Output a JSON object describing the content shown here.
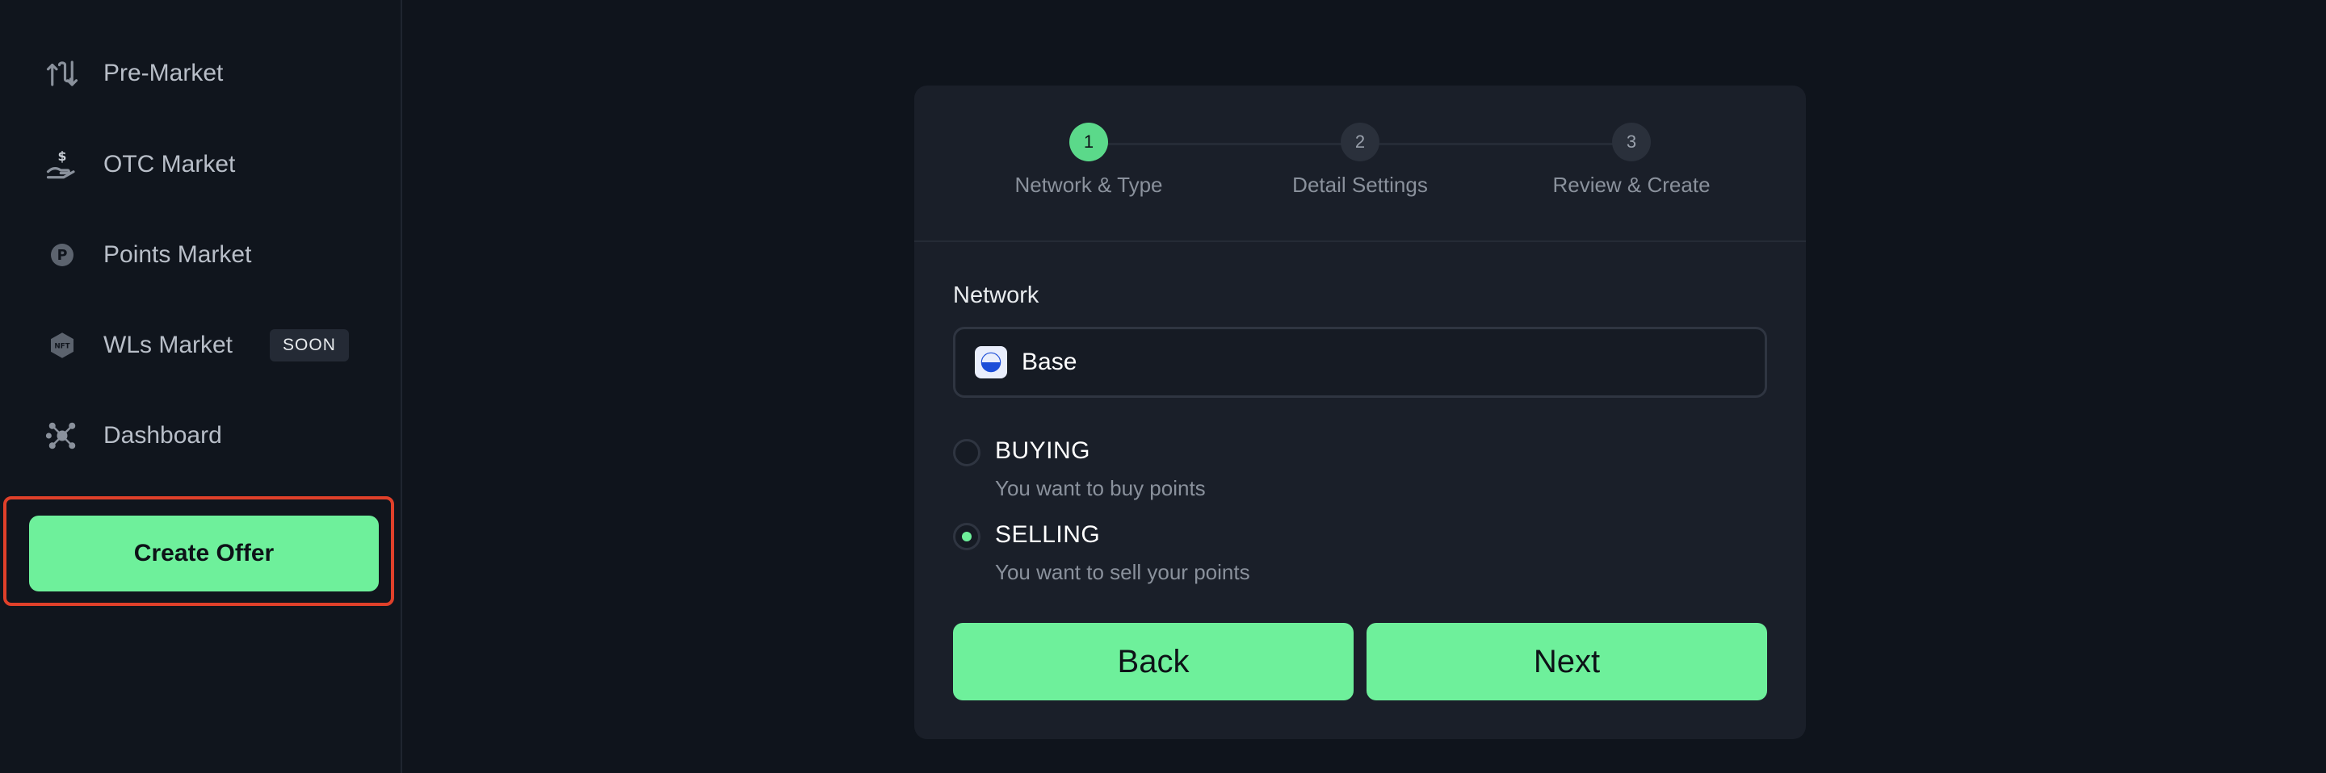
{
  "sidebar": {
    "items": [
      {
        "label": "Pre-Market",
        "icon": "arrows-swap-icon"
      },
      {
        "label": "OTC Market",
        "icon": "hand-dollar-icon"
      },
      {
        "label": "Points Market",
        "icon": "points-coin-icon"
      },
      {
        "label": "WLs Market",
        "icon": "nft-badge-icon",
        "badge": "SOON"
      },
      {
        "label": "Dashboard",
        "icon": "network-icon"
      }
    ],
    "create_offer_label": "Create Offer"
  },
  "wizard": {
    "steps": [
      {
        "number": "1",
        "label": "Network & Type",
        "active": true
      },
      {
        "number": "2",
        "label": "Detail Settings",
        "active": false
      },
      {
        "number": "3",
        "label": "Review & Create",
        "active": false
      }
    ],
    "network_label": "Network",
    "network_value": "Base",
    "options": [
      {
        "title": "BUYING",
        "subtitle": "You want to buy points",
        "selected": false
      },
      {
        "title": "SELLING",
        "subtitle": "You want to sell your points",
        "selected": true
      }
    ],
    "back_label": "Back",
    "next_label": "Next"
  },
  "colors": {
    "accent": "#6ef09b",
    "background": "#0f141c",
    "card": "#1a1f29",
    "highlight_border": "#e0402a"
  }
}
